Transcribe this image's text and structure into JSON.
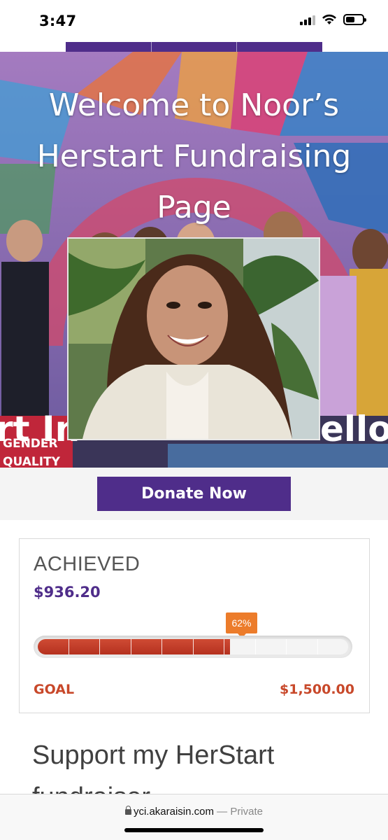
{
  "status_bar": {
    "time": "3:47"
  },
  "hero": {
    "title": "Welcome to Noor’s Herstart Fundraising Page",
    "banner_left_text": "rt In",
    "banner_right_text": "ello",
    "sign_text_line1": "GENDER",
    "sign_text_line2": "QUALITY"
  },
  "donate": {
    "label": "Donate Now"
  },
  "progress": {
    "achieved_label": "ACHIEVED",
    "achieved_amount": "$936.20",
    "percent_label": "62%",
    "percent_value": 0.62,
    "segments": 10,
    "goal_label": "GOAL",
    "goal_amount": "$1,500.00"
  },
  "support": {
    "heading": "Support my HerStart",
    "next_line": "fundraiser"
  },
  "browser": {
    "url": "yci.akaraisin.com",
    "separator": "—",
    "mode": "Private"
  },
  "colors": {
    "brand_purple": "#4f2d8a",
    "progress_red": "#b5311f",
    "goal_orange": "#c8482a",
    "bubble_orange": "#ec7c2b"
  }
}
